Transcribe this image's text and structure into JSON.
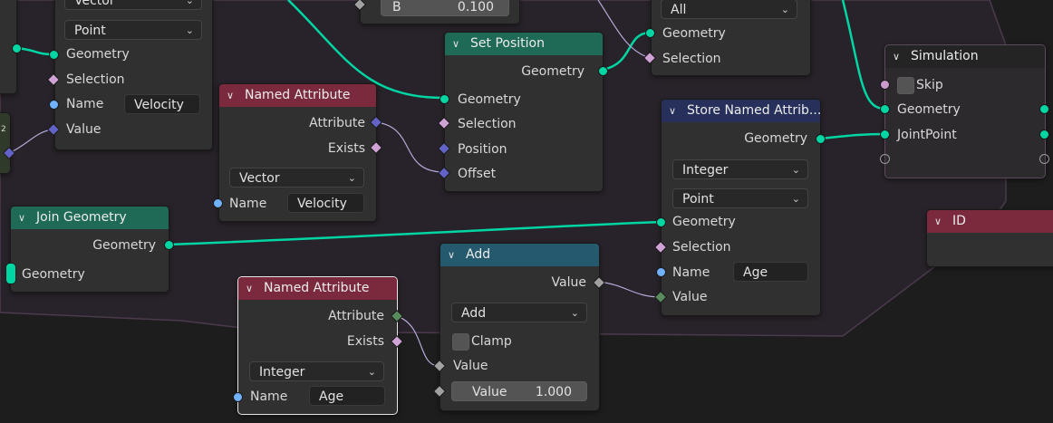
{
  "colors": {
    "background": "#1d1d1d",
    "node_body": "#303030",
    "geometry_header": "#1e6a56",
    "attribute_header": "#7b2a3d",
    "converter_header": "#24596e",
    "store_header": "#26305a",
    "geometry_socket": "#00d6a3",
    "string_socket": "#70b2ff",
    "vector_socket": "#6363c7",
    "float_socket": "#a1a1a1",
    "integer_socket": "#598c5c",
    "field_socket": "#cfa3d6",
    "link_geometry": "#00d6a3",
    "link_field": "#b2a9d6"
  },
  "nodes": {
    "top_left_partial": {
      "dropdown_type": "Vector",
      "dropdown_domain": "Point",
      "geometry_label": "Geometry",
      "selection_label": "Selection",
      "name_label": "Name",
      "name_value": "Velocity",
      "value_label": "Value"
    },
    "combine_partial": {
      "b_label": "B",
      "b_value": "0.100"
    },
    "set_position": {
      "title": "Set Position",
      "out_geometry": "Geometry",
      "in_geometry": "Geometry",
      "in_selection": "Selection",
      "in_position": "Position",
      "in_offset": "Offset"
    },
    "top_right_partial": {
      "dropdown": "All",
      "geometry_label": "Geometry",
      "selection_label": "Selection"
    },
    "named_attribute_velocity": {
      "title": "Named Attribute",
      "out_attribute": "Attribute",
      "out_exists": "Exists",
      "data_type": "Vector",
      "name_label": "Name",
      "name_value": "Velocity"
    },
    "join_geometry": {
      "title": "Join Geometry",
      "out_geometry": "Geometry",
      "in_geometry": "Geometry"
    },
    "named_attribute_age": {
      "title": "Named Attribute",
      "out_attribute": "Attribute",
      "out_exists": "Exists",
      "data_type": "Integer",
      "name_label": "Name",
      "name_value": "Age"
    },
    "add": {
      "title": "Add",
      "out_value": "Value",
      "operation": "Add",
      "clamp_label": "Clamp",
      "in_value_label": "Value",
      "in_value2_label": "Value",
      "in_value2": "1.000"
    },
    "store_named_attribute": {
      "title": "Store Named Attrib...",
      "out_geometry": "Geometry",
      "data_type": "Integer",
      "domain": "Point",
      "in_geometry": "Geometry",
      "in_selection": "Selection",
      "name_label": "Name",
      "name_value": "Age",
      "value_label": "Value"
    },
    "simulation": {
      "title": "Simulation",
      "skip_label": "Skip",
      "geometry_label": "Geometry",
      "joint_label": "JointPoint"
    },
    "id": {
      "title": "ID"
    },
    "left_edge": {
      "label_2": "2"
    }
  }
}
